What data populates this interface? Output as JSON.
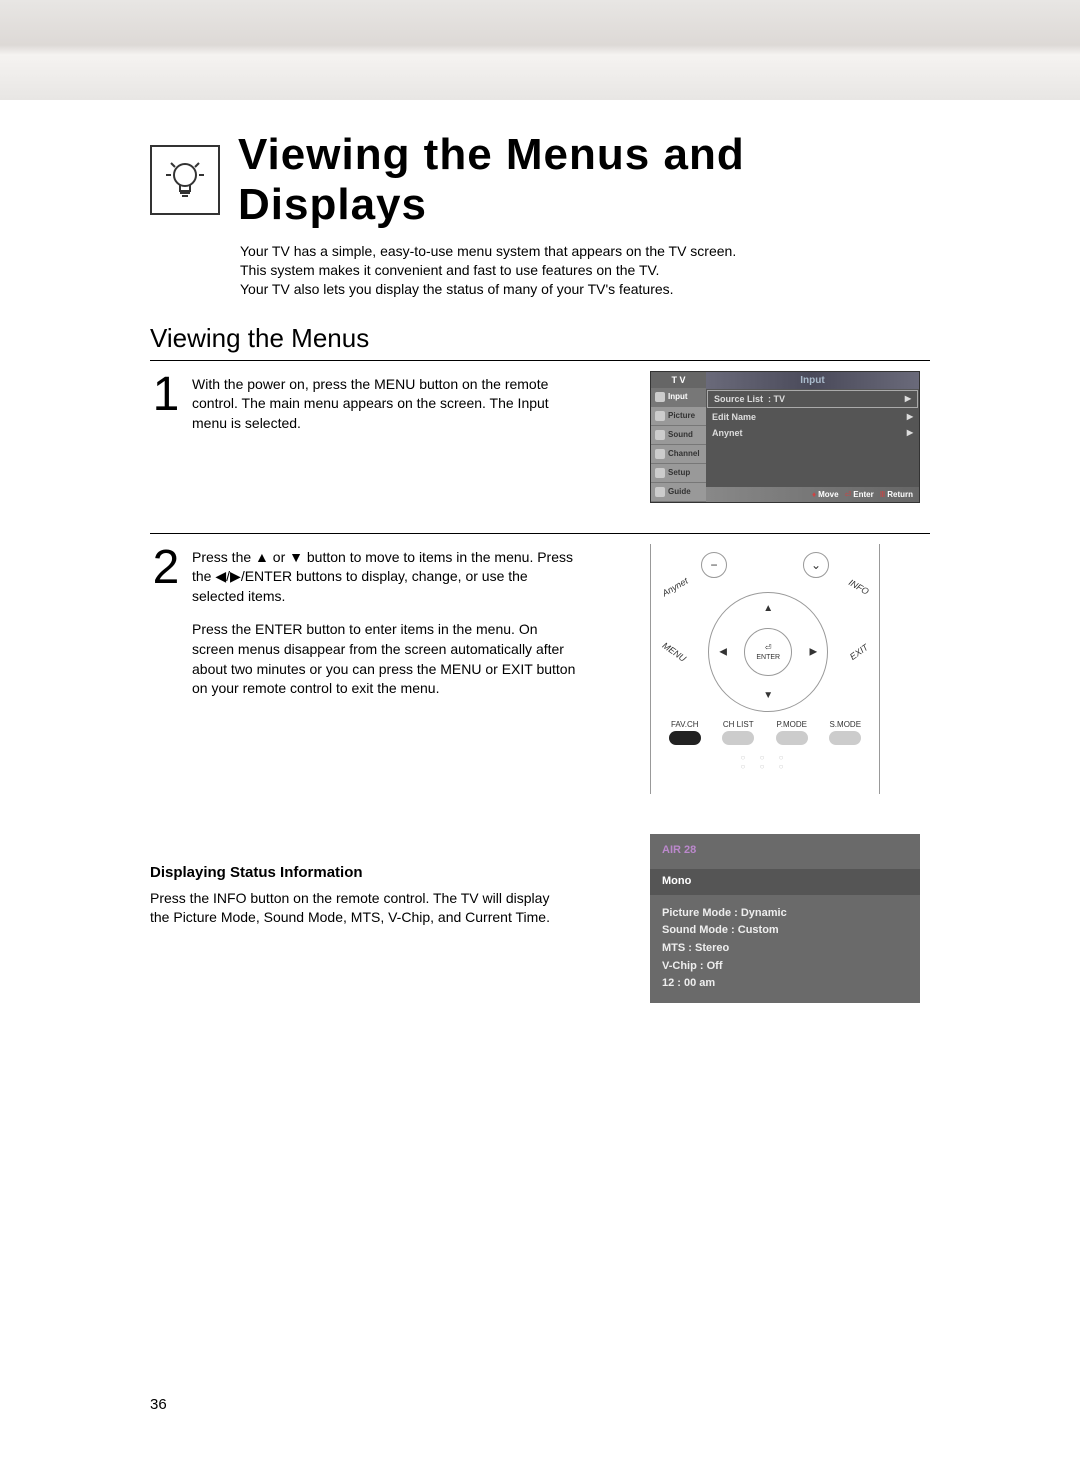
{
  "header_title": "Viewing the Menus and Displays",
  "intro_l1": "Your TV has a simple, easy-to-use menu system that appears on the TV screen.",
  "intro_l2": "This system makes it convenient and fast to use features on the TV.",
  "intro_l3": "Your TV also lets you display the status of many of your TV's features.",
  "section_title": "Viewing the Menus",
  "step1_num": "1",
  "step1_text": "With the power on, press the MENU button on the remote control. The main menu appears on the screen. The Input menu is selected.",
  "step2_num": "2",
  "step2_p1_a": "Press the ",
  "step2_p1_b": " or ",
  "step2_p1_c": " button to move to items in the menu. Press the ",
  "step2_p1_d": "/ENTER buttons to display, change, or use the selected items.",
  "step2_p2": "Press the ENTER button to enter items in the menu. On screen menus disappear from the screen automatically after about two minutes or you can press the MENU or EXIT button on your remote control to exit the menu.",
  "sub_heading": "Displaying Status Information",
  "status_text": "Press the INFO button on the remote control. The TV will display the Picture Mode, Sound Mode, MTS, V-Chip, and Current Time.",
  "page_num": "36",
  "osd": {
    "tv": "T V",
    "title": "Input",
    "tabs": [
      "Input",
      "Picture",
      "Sound",
      "Channel",
      "Setup",
      "Guide"
    ],
    "row1_label": "Source List",
    "row1_val": ": TV",
    "row2_label": "Edit Name",
    "row3_label": "Anynet",
    "foot_move": "Move",
    "foot_enter": "Enter",
    "foot_return": "Return"
  },
  "remote": {
    "anynet": "Anynet",
    "info": "INFO",
    "menu": "MENU",
    "exit": "EXIT",
    "enter": "ENTER",
    "buttons": [
      "FAV.CH",
      "CH LIST",
      "P.MODE",
      "S.MODE"
    ]
  },
  "status": {
    "ch": "AIR 28",
    "audio": "Mono",
    "pm": "Picture Mode : Dynamic",
    "sm": "Sound Mode : Custom",
    "mts": "MTS : Stereo",
    "vchip": "V-Chip : Off",
    "time": "12 : 00 am"
  }
}
